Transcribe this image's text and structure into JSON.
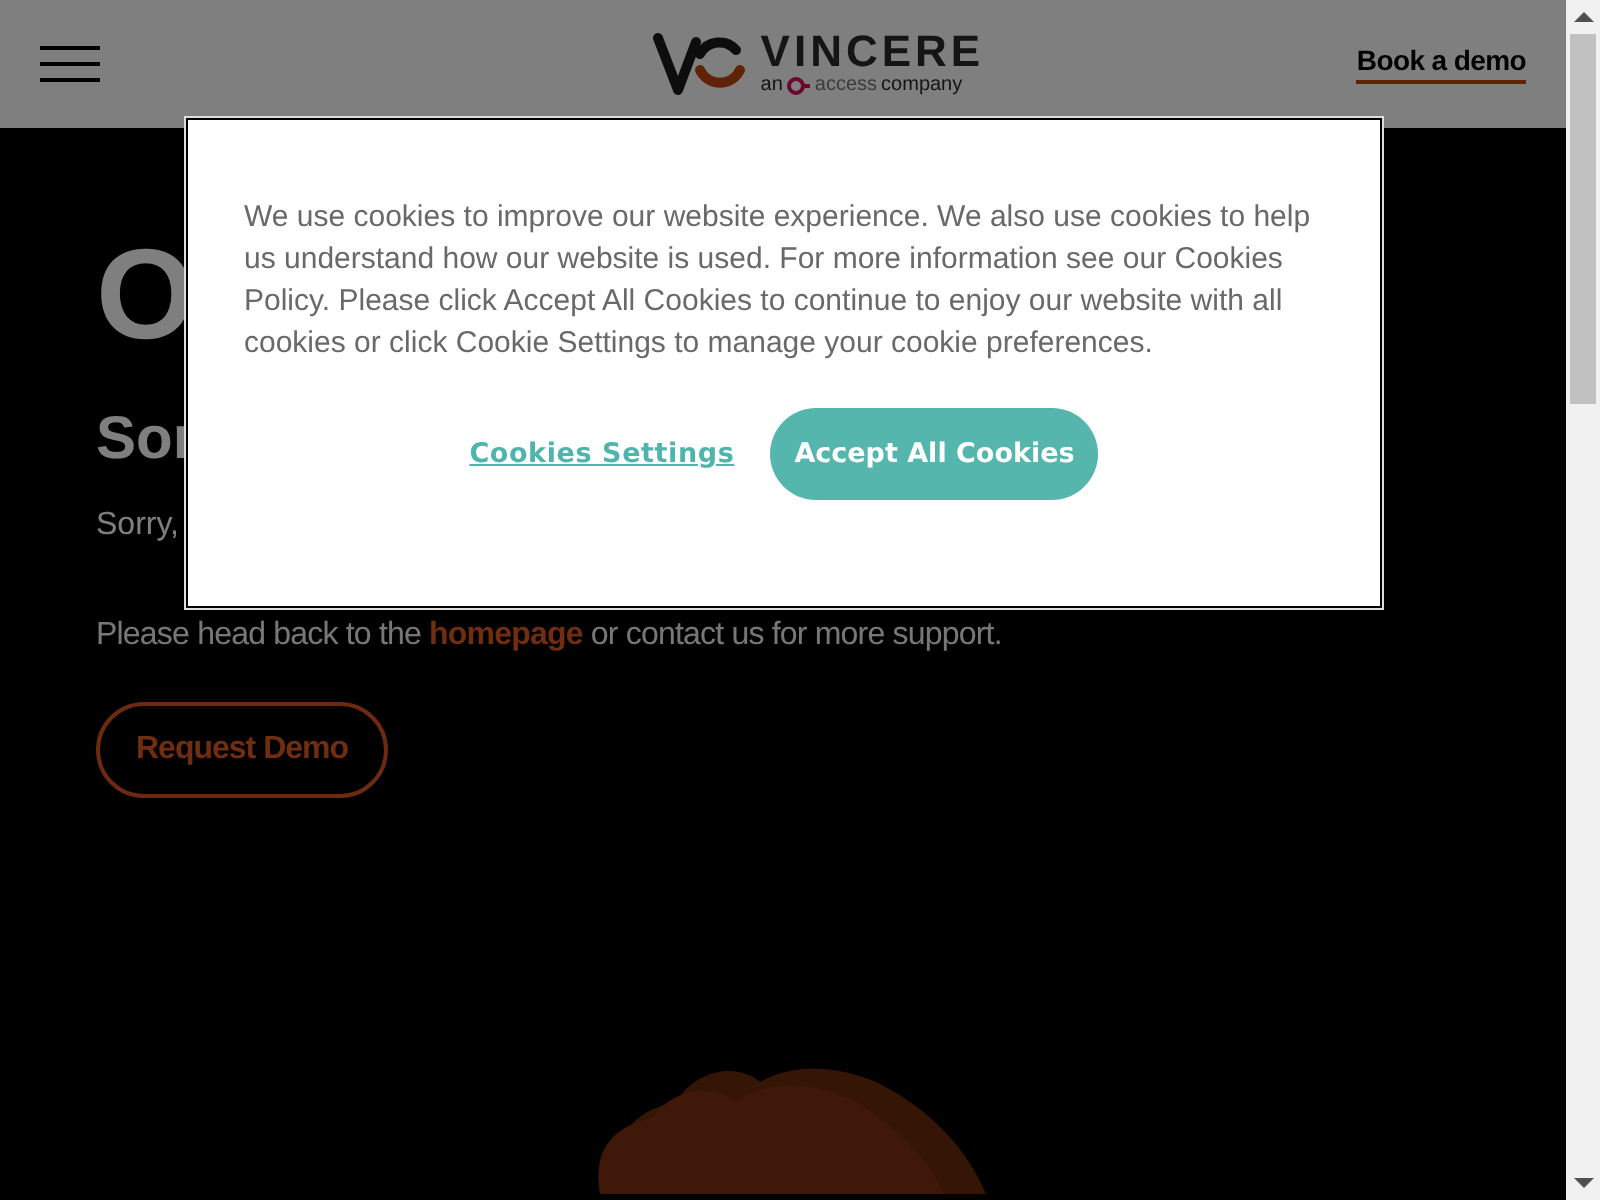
{
  "header": {
    "brand": {
      "name": "VINCERE",
      "tagline": [
        "an",
        "access",
        "company"
      ]
    },
    "cta": "Book a demo"
  },
  "content": {
    "heading": "O",
    "subheading": "Sor",
    "message": "Sorry,",
    "help": {
      "before": "Please head back to the",
      "link": "homepage",
      "after": "or contact us for more support."
    },
    "button": "Request Demo"
  },
  "cookie_banner": {
    "text": "We use cookies to improve our website experience. We also use cookies to help us understand how our website is used. For more information see our Cookies Policy. Please click Accept All Cookies to continue to enjoy our website with all cookies or click Cookie Settings to manage your cookie preferences.",
    "settings": "Cookies Settings",
    "accept": "Accept All Cookies"
  }
}
